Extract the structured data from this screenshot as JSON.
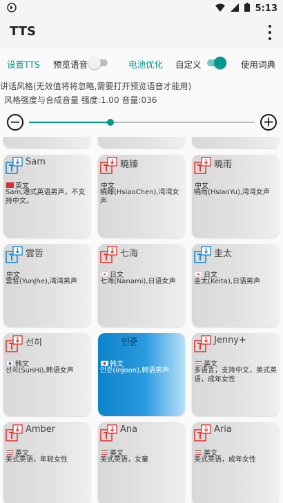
{
  "status": {
    "time": "5:13"
  },
  "app": {
    "title": "TTS"
  },
  "tabs": [
    {
      "label": "设置TTS",
      "color": "#009688"
    },
    {
      "label": "预览语音",
      "color": "#222222"
    },
    {
      "label": "电池优化",
      "color": "#009688"
    },
    {
      "label": "自定义",
      "color": "#222222"
    },
    {
      "label": "使用词典",
      "color": "#222222"
    }
  ],
  "toggles": {
    "preview": false,
    "custom": true
  },
  "description": "讲话风格(无效值将将忽略,需要打开预览语音才能用)",
  "style_line": "风格强度与合成音量  强度:1.00 音量:036",
  "slider": {
    "value": 0.36,
    "minus": "−",
    "plus": "+"
  },
  "voices": [
    {
      "name": "Sam",
      "lang": "英文",
      "info": "Sam,港式英语男声，不支持中文。",
      "icon": "blue",
      "flag": "hk"
    },
    {
      "name": "曉臻",
      "lang": "中文",
      "info": "曉臻(HsiaoChen),湾湾女声",
      "icon": "red",
      "flag": ""
    },
    {
      "name": "曉雨",
      "lang": "中文",
      "info": "曉雨(HsiaoYu),湾湾女声",
      "icon": "red",
      "flag": ""
    },
    {
      "name": "雲哲",
      "lang": "中文",
      "info": "雲哲(YunJhe),湾湾男声",
      "icon": "blue",
      "flag": ""
    },
    {
      "name": "七海",
      "lang": "日文",
      "info": "七海(Nanami),日语女声",
      "icon": "red",
      "flag": "jp"
    },
    {
      "name": "圭太",
      "lang": "日文",
      "info": "圭太(Keita),日语男声",
      "icon": "blue",
      "flag": "jp"
    },
    {
      "name": "선히",
      "lang": "韩文",
      "info": "선히(SunHi),韩语女声",
      "icon": "red",
      "flag": "kr"
    },
    {
      "name": "인준",
      "lang": "韩文",
      "info": "인준(InJoon),韩语男声",
      "icon": "blue",
      "flag": "kr",
      "selected": true
    },
    {
      "name": "Jenny+",
      "lang": "英文",
      "info": "多语言，支持中文，美式英语，成年女性",
      "icon": "red",
      "flag": "us"
    },
    {
      "name": "Amber",
      "lang": "英文",
      "info": "美式英语，年轻女性",
      "icon": "red",
      "flag": "us"
    },
    {
      "name": "Ana",
      "lang": "英文",
      "info": "美式英语，女童",
      "icon": "red",
      "flag": "us"
    },
    {
      "name": "Aria",
      "lang": "英文",
      "info": "美式英语，成年女性",
      "icon": "red",
      "flag": "us"
    }
  ],
  "colors": {
    "accent": "#009b8d",
    "icon_blue": "#1e88d6",
    "icon_red": "#e53935"
  }
}
